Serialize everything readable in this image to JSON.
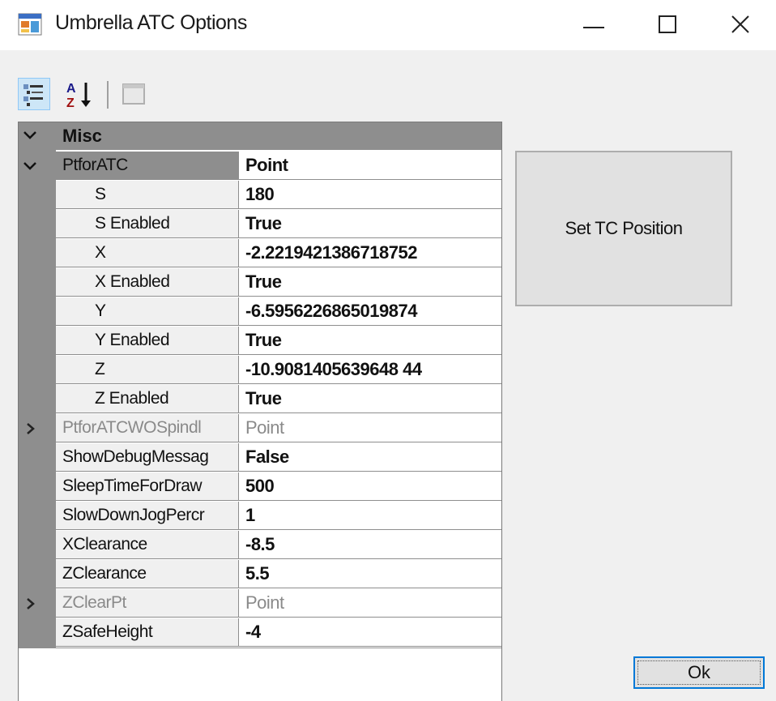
{
  "window": {
    "title": "Umbrella ATC Options",
    "icon": "app-window-icon"
  },
  "toolbar": {
    "buttons": [
      {
        "name": "categorized",
        "icon": "categorized-icon",
        "active": true
      },
      {
        "name": "alphabetical",
        "icon": "alphabetical-sort-icon",
        "active": false
      },
      {
        "name": "property-pages",
        "icon": "property-pages-icon",
        "active": false,
        "disabled": true
      }
    ]
  },
  "grid": {
    "category": "Misc",
    "rows": [
      {
        "name": "PtforATC",
        "value": "Point",
        "expanded": true
      },
      {
        "name": "S",
        "value": "180",
        "child": true
      },
      {
        "name": "S Enabled",
        "value": "True",
        "child": true
      },
      {
        "name": "X",
        "value": "-2.2219421386718752",
        "child": true
      },
      {
        "name": "X Enabled",
        "value": "True",
        "child": true
      },
      {
        "name": "Y",
        "value": "-6.5956226865019874",
        "child": true
      },
      {
        "name": "Y Enabled",
        "value": "True",
        "child": true
      },
      {
        "name": "Z",
        "value": "-10.9081405639648 44",
        "child": true
      },
      {
        "name": "Z Enabled",
        "value": "True",
        "child": true
      },
      {
        "name": "PtforATCWOSpindl",
        "value": "Point",
        "collapsed": true,
        "dim": true
      },
      {
        "name": "ShowDebugMessag",
        "value": "False"
      },
      {
        "name": "SleepTimeForDraw",
        "value": "500"
      },
      {
        "name": "SlowDownJogPercr",
        "value": "1"
      },
      {
        "name": "XClearance",
        "value": "-8.5"
      },
      {
        "name": "ZClearance",
        "value": "5.5"
      },
      {
        "name": "ZClearPt",
        "value": "Point",
        "collapsed": true,
        "dim": true
      },
      {
        "name": "ZSafeHeight",
        "value": "-4"
      }
    ]
  },
  "buttons": {
    "set_tc_position": "Set TC Position",
    "ok": "Ok"
  },
  "colors": {
    "gutter": "#8e8e8e",
    "accent": "#0078d7"
  }
}
